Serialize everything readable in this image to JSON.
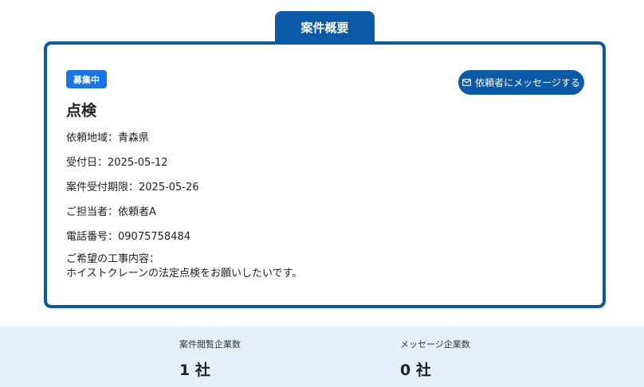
{
  "tab": {
    "label": "案件概要"
  },
  "case": {
    "status_badge": "募集中",
    "message_button": "依頼者にメッセージする",
    "title": "点検",
    "fields": {
      "region": "依頼地域：青森県",
      "received_date": "受付日：2025-05-12",
      "deadline": "案件受付期限：2025-05-26",
      "contact": "ご担当者：依頼者A",
      "phone": "電話番号：09075758484"
    },
    "description_label": "ご希望の工事内容：",
    "description": "ホイストクレーンの法定点検をお願いしたいです。"
  },
  "stats": {
    "views_label": "案件閲覧企業数",
    "views_value": "1 社",
    "messages_label": "メッセージ企業数",
    "messages_value": "0 社"
  },
  "colors": {
    "primary": "#0b5aa8",
    "badge": "#1a73e8",
    "stats_bg": "#e6f0fa"
  }
}
